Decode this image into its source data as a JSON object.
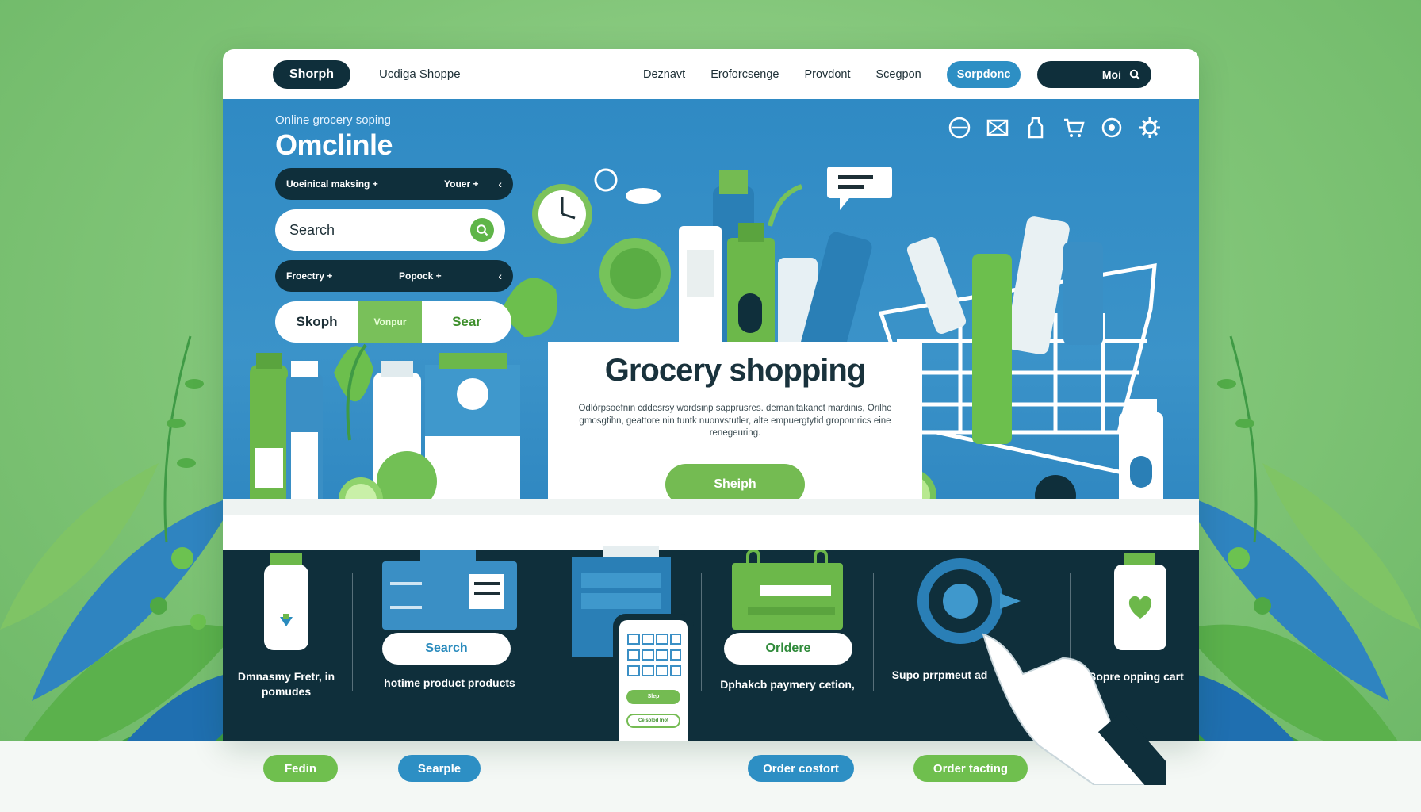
{
  "nav": {
    "brand_pill": "Shorph",
    "brand_name": "Ucdiga Shoppe",
    "links": [
      "Deznavt",
      "Eroforcsenge",
      "Provdont",
      "Scegpon"
    ],
    "active": "Sorpdonc",
    "search_label": "Moi"
  },
  "hero": {
    "eyebrow": "Online grocery soping",
    "title": "Omclinle",
    "select1": {
      "left": "Uoeinical maksing +",
      "right": "Youer +"
    },
    "search_placeholder": "Search",
    "select2": {
      "left": "Froectry +",
      "right": "Popock +"
    },
    "tabs": [
      "Skoph",
      "Vonpur",
      "Sear"
    ],
    "card_title": "Grocery shopping",
    "card_text": "Odlόrpsoefnin cddesrsy wordsinp sapprusres. demanitakanct mardinis, Orilhe gmosgtihn, geattore nin tuntk nuonvstutler, alte empuergtytid gropomrics eine renegeuring.",
    "card_cta": "Sheiph"
  },
  "features": [
    {
      "caption": "Dmnasmy Fretr, in pomudes"
    },
    {
      "button": "Search",
      "caption": "hotime product products"
    },
    {
      "phone_buttons": [
        "Slep",
        "Ceisolod Inot"
      ]
    },
    {
      "button": "Orldere",
      "caption": "Dphakcb paymery cetion,"
    },
    {
      "caption": "Supo prrpmeut ad"
    },
    {
      "caption": "Bopre opping cart"
    }
  ],
  "chips": [
    {
      "label": "Fedin",
      "color": "#6fbf4e"
    },
    {
      "label": "Searple",
      "color": "#2d8fc4"
    },
    {
      "label": "Order costort",
      "color": "#2d8fc4"
    },
    {
      "label": "Order tacting",
      "color": "#6fbf4e"
    }
  ],
  "colors": {
    "dark": "#0f2f3b",
    "blue": "#2d8fc4",
    "green": "#6fbf4e",
    "bg": "#7fc476"
  }
}
